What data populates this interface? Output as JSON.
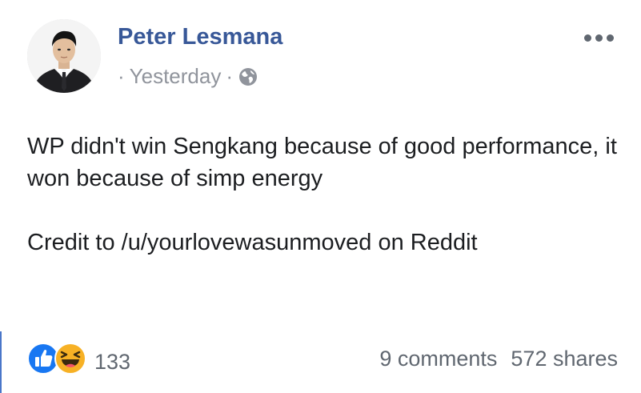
{
  "post": {
    "author": "Peter Lesmana",
    "meta": {
      "dot": "·",
      "time": "Yesterday",
      "privacy_icon": "globe-icon"
    },
    "menu_icon": "more-icon",
    "text": {
      "line1": "WP didn't win Sengkang because of good performance, it won because of simp energy",
      "line2": "Credit to /u/yourlovewasunmoved on Reddit"
    },
    "reactions": {
      "icons": [
        "like-icon",
        "haha-icon"
      ],
      "count": "133"
    },
    "stats": {
      "comments": "9 comments",
      "shares": "572 shares"
    }
  },
  "colors": {
    "author_link": "#385898",
    "meta_text": "#90949c",
    "like_blue": "#1877f2",
    "haha_yellow": "#f7b125",
    "accent_rule": "#4a76c9"
  }
}
